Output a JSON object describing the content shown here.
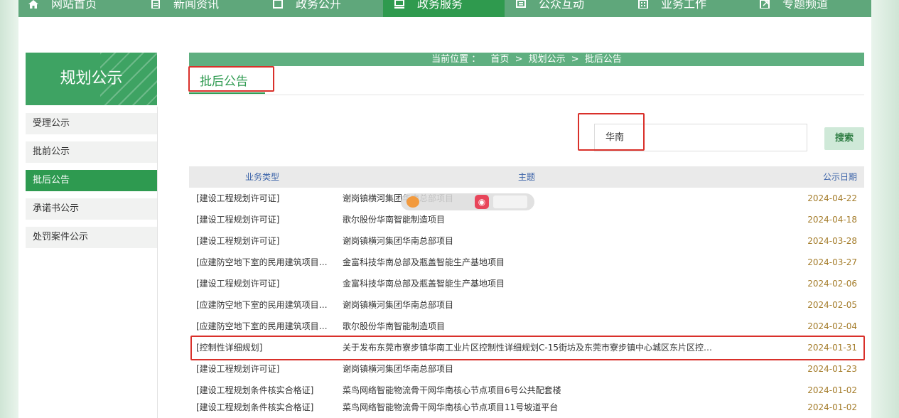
{
  "nav": {
    "items": [
      {
        "label": "网站首页",
        "icon": "home-icon"
      },
      {
        "label": "新闻资讯",
        "icon": "document-icon"
      },
      {
        "label": "政务公开",
        "icon": "window-icon"
      },
      {
        "label": "政务服务",
        "icon": "monitor-icon",
        "active": true
      },
      {
        "label": "公众互动",
        "icon": "chat-icon"
      },
      {
        "label": "业务工作",
        "icon": "building-icon"
      },
      {
        "label": "专题频道",
        "icon": "external-icon"
      }
    ]
  },
  "sidebar": {
    "title": "规划公示",
    "items": [
      {
        "label": "受理公示"
      },
      {
        "label": "批前公示"
      },
      {
        "label": "批后公告",
        "active": true
      },
      {
        "label": "承诺书公示"
      },
      {
        "label": "处罚案件公示"
      }
    ]
  },
  "breadcrumb": {
    "prefix": "当前位置 ：",
    "items": [
      "首页",
      "规划公示",
      "批后公告"
    ],
    "separator": ">"
  },
  "section": {
    "title": "批后公告"
  },
  "search": {
    "value": "华南",
    "button_label": "搜索"
  },
  "table": {
    "headers": [
      "业务类型",
      "主题",
      "公示日期"
    ],
    "rows": [
      {
        "type": "[建设工程规划许可证]",
        "subject": "谢岗镇横河集团华南总部项目",
        "date": "2024-04-22"
      },
      {
        "type": "[建设工程规划许可证]",
        "subject": "歌尔股份华南智能制造项目",
        "date": "2024-04-18"
      },
      {
        "type": "[建设工程规划许可证]",
        "subject": "谢岗镇横河集团华南总部项目",
        "date": "2024-03-28"
      },
      {
        "type": "[应建防空地下室的民用建筑项目…",
        "subject": "金富科技华南总部及瓶盖智能生产基地项目",
        "date": "2024-03-27"
      },
      {
        "type": "[建设工程规划许可证]",
        "subject": "金富科技华南总部及瓶盖智能生产基地项目",
        "date": "2024-02-06"
      },
      {
        "type": "[应建防空地下室的民用建筑项目…",
        "subject": "谢岗镇横河集团华南总部项目",
        "date": "2024-02-05"
      },
      {
        "type": "[应建防空地下室的民用建筑项目…",
        "subject": "歌尔股份华南智能制造项目",
        "date": "2024-02-04"
      },
      {
        "type": "[控制性详细规划]",
        "subject": "关于发布东莞市寮步镇华南工业片区控制性详细规划C-15街坊及东莞市寮步镇中心城区东片区控…",
        "date": "2024-01-31"
      },
      {
        "type": "[建设工程规划许可证]",
        "subject": "谢岗镇横河集团华南总部项目",
        "date": "2024-01-23"
      },
      {
        "type": "[建设工程规划条件核实合格证]",
        "subject": "菜鸟网络智能物流骨干网华南核心节点项目6号公共配套楼",
        "date": "2024-01-02"
      },
      {
        "type": "[建设工程规划条件核实合格证]",
        "subject": "菜鸟网络智能物流骨干网华南核心节点项目11号坡道平台",
        "date": "2024-01-02"
      }
    ]
  },
  "colors": {
    "nav_bg": "#5fa77b",
    "nav_active": "#2f9a4e",
    "accent": "#2e9a50",
    "date": "#a47c2a",
    "highlight": "#d9302a"
  }
}
